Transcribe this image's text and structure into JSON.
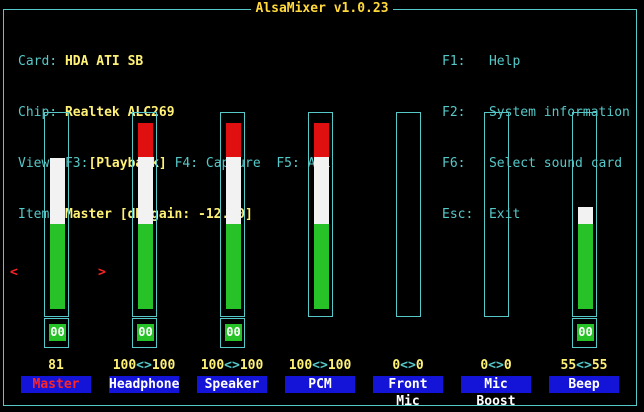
{
  "title": "AlsaMixer v1.0.23",
  "info": {
    "card_label": "Card:",
    "card": "HDA ATI SB",
    "chip_label": "Chip:",
    "chip": "Realtek ALC269",
    "view_label": "View:",
    "view_f3": "F3:",
    "view_playback": "[Playback]",
    "view_f4": "F4: Capture",
    "view_f5": "F5: All",
    "item_label": "Item:",
    "item": "Master [dB gain: -12.00]"
  },
  "help": {
    "f1_key": "F1:",
    "f1": "Help",
    "f2_key": "F2:",
    "f2": "System information",
    "f6_key": "F6:",
    "f6": "Select sound card",
    "esc_key": "Esc:",
    "esc": "Exit"
  },
  "mute_label": "00",
  "colors": {
    "border": "#56c8c8",
    "green": "#27c227",
    "white": "#f2f2f2",
    "red": "#e01010",
    "name_bg": "#1414d8"
  },
  "channels": [
    {
      "name": "Master",
      "left": "81",
      "sep": "",
      "right": "",
      "level": 0.81,
      "muted_box": true,
      "active": true
    },
    {
      "name": "Headphone",
      "left": "100",
      "sep": "<>",
      "right": "100",
      "level": 1.0,
      "muted_box": true,
      "active": false
    },
    {
      "name": "Speaker",
      "left": "100",
      "sep": "<>",
      "right": "100",
      "level": 1.0,
      "muted_box": true,
      "active": false
    },
    {
      "name": "PCM",
      "left": "100",
      "sep": "<>",
      "right": "100",
      "level": 1.0,
      "muted_box": false,
      "active": false
    },
    {
      "name": "Front Mic",
      "left": "0",
      "sep": "<>",
      "right": "0",
      "level": 0,
      "muted_box": false,
      "active": false
    },
    {
      "name": "Mic Boost",
      "left": "0",
      "sep": "<>",
      "right": "0",
      "level": 0,
      "muted_box": false,
      "active": false
    },
    {
      "name": "Beep",
      "left": "55",
      "sep": "<>",
      "right": "55",
      "level": 0.55,
      "muted_box": true,
      "active": false
    }
  ],
  "nav": {
    "left_arrow": "<",
    "right_arrow": ">"
  }
}
